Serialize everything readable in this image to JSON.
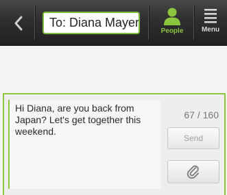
{
  "header": {
    "to_field_text": "To: Diana Mayer",
    "people_label": "People",
    "menu_label": "Menu"
  },
  "compose": {
    "message": "Hi Diana, are you back from Japan? Let's get together this weekend.",
    "char_count": "67 / 160",
    "send_label": "Send"
  },
  "icons": {
    "back": "chevron-left-icon",
    "people": "person-icon",
    "menu": "menu-icon",
    "attach": "paperclip-icon"
  },
  "colors": {
    "accent": "#8cc63f",
    "toolbar": "#2f2f2f"
  }
}
